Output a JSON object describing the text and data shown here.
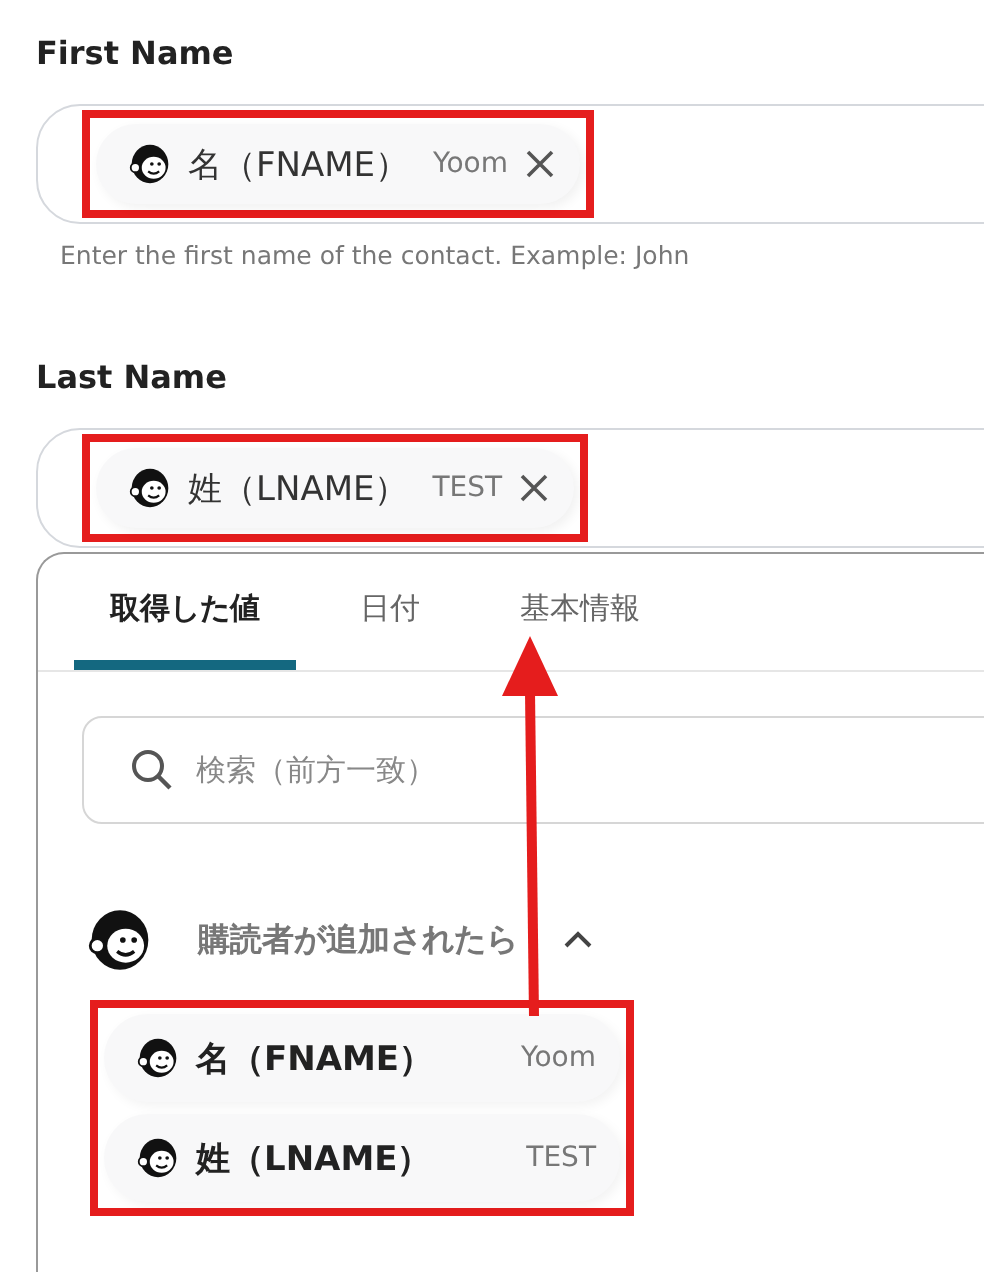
{
  "fields": [
    {
      "label": "First Name",
      "chip": {
        "name": "名（FNAME）",
        "value": "Yoom",
        "highlighted": true
      },
      "hint": "Enter the first name of the contact. Example: John"
    },
    {
      "label": "Last Name",
      "chip": {
        "name": "姓（LNAME）",
        "value": "TEST",
        "highlighted": true
      }
    }
  ],
  "picker": {
    "tabs": [
      {
        "label": "取得した値",
        "selected": true
      },
      {
        "label": "日付",
        "selected": false
      },
      {
        "label": "基本情報",
        "selected": false
      }
    ],
    "search": {
      "placeholder": "検索（前方一致）"
    },
    "group": {
      "title": "購読者が追加されたら",
      "expanded": true,
      "items_highlighted": true,
      "items": [
        {
          "name": "名（FNAME）",
          "value": "Yoom"
        },
        {
          "name": "姓（LNAME）",
          "value": "TEST"
        }
      ]
    }
  }
}
